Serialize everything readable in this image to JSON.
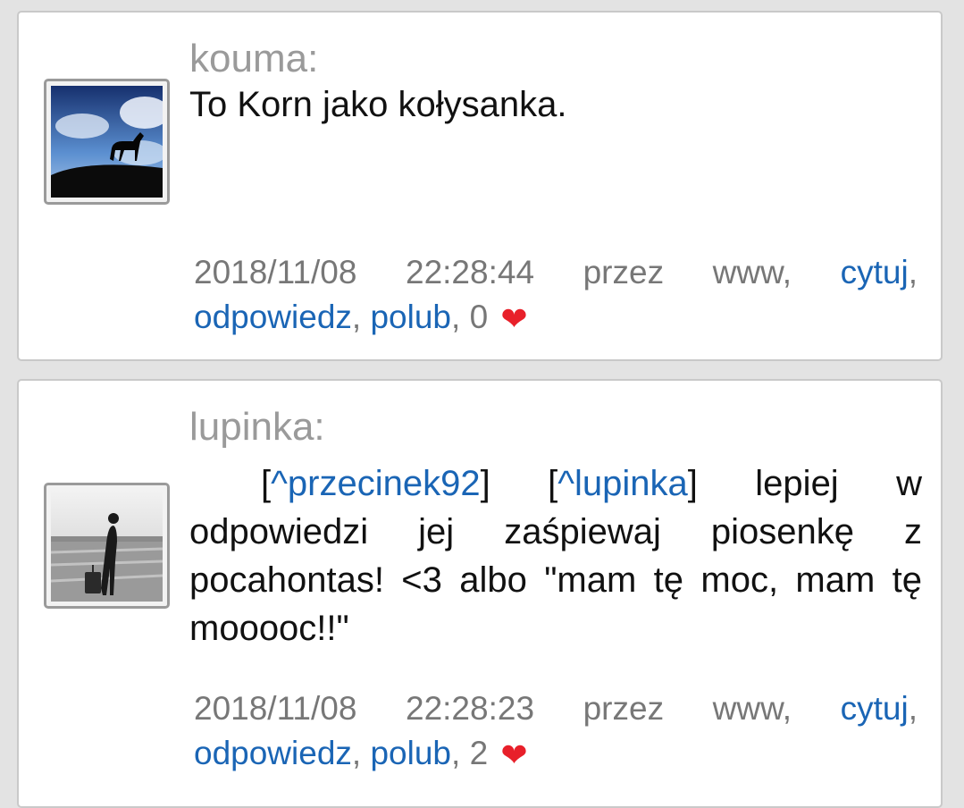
{
  "posts": [
    {
      "author": "kouma:",
      "body": "To Korn jako kołysanka.",
      "date": "2018/11/08",
      "time": "22:28:44",
      "via": "przez",
      "source": "www,",
      "actions": {
        "quote": "cytuj",
        "reply": "odpowiedz",
        "like": "polub"
      },
      "likes": "0",
      "heart": "❤"
    },
    {
      "author": "lupinka:",
      "body_parts": {
        "m1_open": "[",
        "m1": "^przecinek92",
        "m1_close": "]",
        "m2_open": "[",
        "m2": "^lupinka",
        "m2_close": "]",
        "text": "lepiej w odpowiedzi jej zaśpiewaj piosenkę z pocahontas! <3 albo \"mam tę moc, mam tę mooooc!!\""
      },
      "date": "2018/11/08",
      "time": "22:28:23",
      "via": "przez",
      "source": "www,",
      "actions": {
        "quote": "cytuj",
        "reply": "odpowiedz",
        "like": "polub"
      },
      "likes": "2",
      "heart": "❤"
    }
  ],
  "colors": {
    "link": "#1a65b5",
    "meta": "#777777",
    "heart": "#e8202a",
    "author": "#9a9a9a"
  }
}
